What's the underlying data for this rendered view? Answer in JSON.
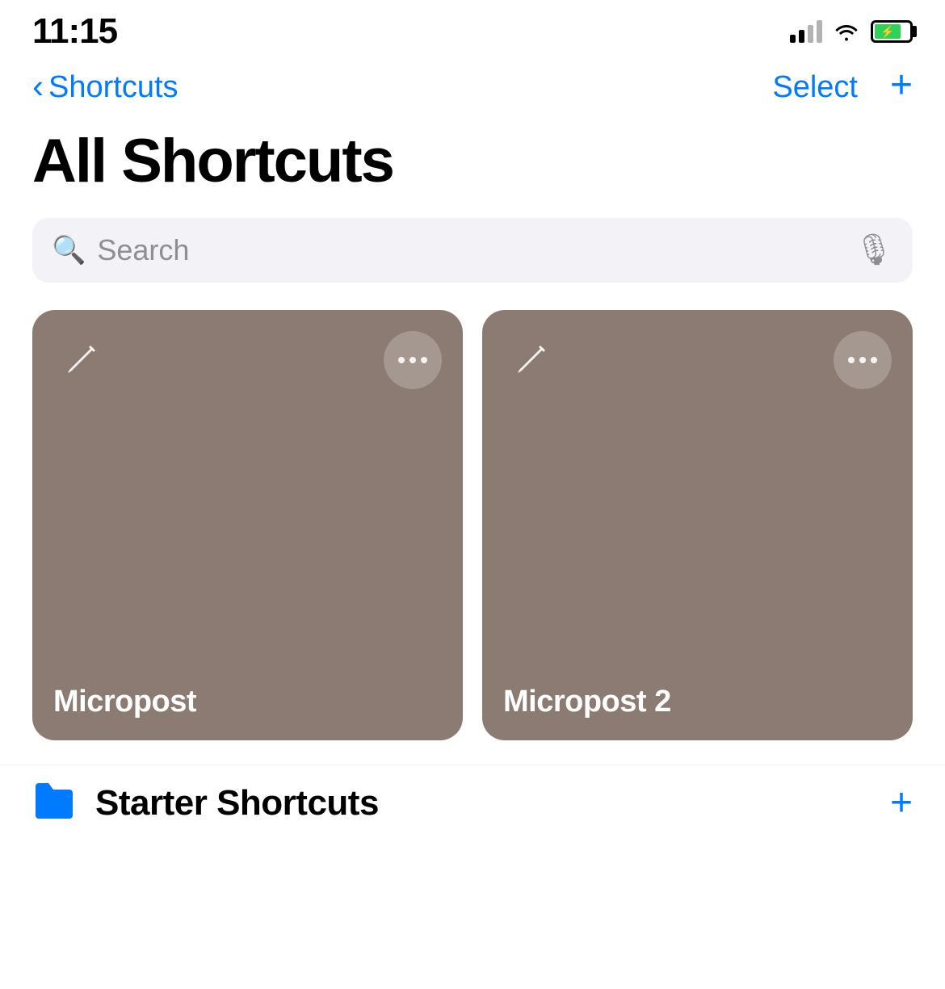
{
  "statusBar": {
    "time": "11:15",
    "batteryPercent": 75
  },
  "navBar": {
    "backLabel": "Shortcuts",
    "selectLabel": "Select",
    "addLabel": "+"
  },
  "pageTitle": "All Shortcuts",
  "searchBar": {
    "placeholder": "Search"
  },
  "shortcuts": [
    {
      "id": 1,
      "name": "Micropost",
      "color": "#8b7b73"
    },
    {
      "id": 2,
      "name": "Micropost 2",
      "color": "#8b7b73"
    }
  ],
  "bottomSection": {
    "folderLabel": "Starter Shortcuts",
    "addLabel": "+"
  }
}
